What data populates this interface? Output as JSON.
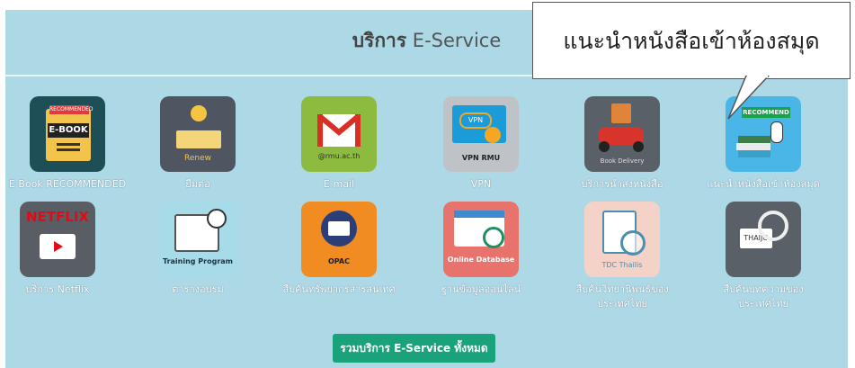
{
  "header": {
    "title_bold": "บริการ",
    "title_rest": " E-Service"
  },
  "callout": {
    "text": "แนะนำหนังสือเข้าห้องสมุด"
  },
  "tiles": [
    {
      "label": "E-Book RECOMMENDED",
      "icon": "ebook-icon",
      "badge": "RECOMMENDED",
      "text": "E-BOOK"
    },
    {
      "label": "ยืมต่อ",
      "icon": "renew-icon",
      "text": "Renew"
    },
    {
      "label": "E-mail",
      "icon": "gmail-icon",
      "text": "@rmu.ac.th"
    },
    {
      "label": "VPN",
      "icon": "vpn-icon",
      "badge": "VPN",
      "text": "VPN RMU"
    },
    {
      "label": "บริการนำส่งหนังสือ",
      "icon": "book-delivery-icon",
      "text": "Book Delivery"
    },
    {
      "label": "แนะนำหนังสือเข้าห้องสมุด",
      "icon": "recommend-icon",
      "badge": "RECOMMEND"
    },
    {
      "label": "บริการ Netflix",
      "icon": "netflix-icon",
      "text": "NETFLIX"
    },
    {
      "label": "ตารางอบรม",
      "icon": "training-icon",
      "text": "Training Program"
    },
    {
      "label": "สืบค้นทรัพยากรสารสนเทศ",
      "icon": "opac-icon",
      "text": "OPAC"
    },
    {
      "label": "ฐานข้อมูลออนไลน์",
      "icon": "online-database-icon",
      "text": "Online Database"
    },
    {
      "label": "สืบค้นวิทยานิพนธ์ของ\nประเทศไทย",
      "icon": "tdc-thailis-icon",
      "text": "TDC ThaiIis"
    },
    {
      "label": "สืบค้นบทความของ\nประเทศไทย",
      "icon": "thaijo-icon",
      "text": "THAIJO"
    }
  ],
  "all_button": {
    "label": "รวมบริการ E-Service ทั้งหมด"
  },
  "colors": {
    "panel": "#add8e6",
    "button": "#1aa37a"
  }
}
